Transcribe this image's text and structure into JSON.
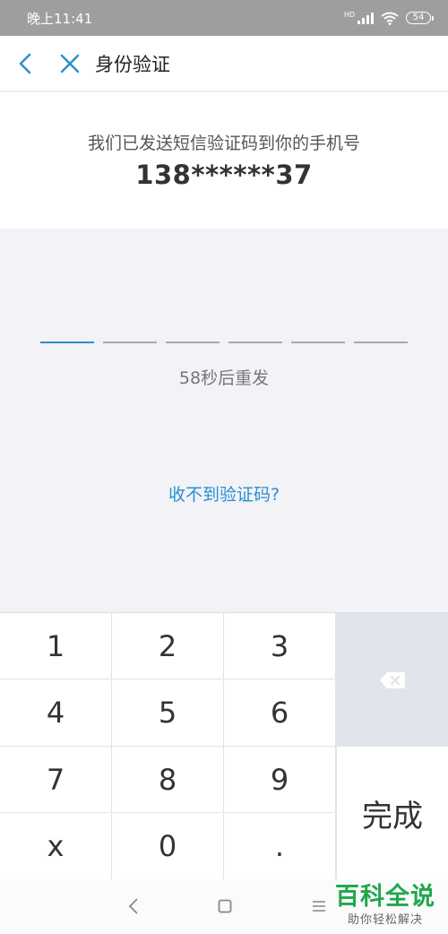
{
  "status_bar": {
    "time": "晚上11:41",
    "network_tag": "HD",
    "battery_level": "54"
  },
  "nav": {
    "title": "身份验证"
  },
  "info": {
    "message": "我们已发送短信验证码到你的手机号",
    "phone": "138******37"
  },
  "code": {
    "slots": 6,
    "active_index": 0,
    "countdown": "58秒后重发",
    "no_code_link": "收不到验证码?"
  },
  "keypad": {
    "keys": [
      "1",
      "2",
      "3",
      "4",
      "5",
      "6",
      "7",
      "8",
      "9",
      "x",
      "0",
      "."
    ],
    "done_label": "完成"
  },
  "watermark": {
    "brand": "百科全说",
    "slogan": "助你轻松解决"
  },
  "colors": {
    "accent": "#2a8fd1",
    "status_bar": "#9e9e9e",
    "background": "#f2f2f7",
    "backspace_key": "#e1e4ea",
    "watermark": "#1fa84b"
  }
}
